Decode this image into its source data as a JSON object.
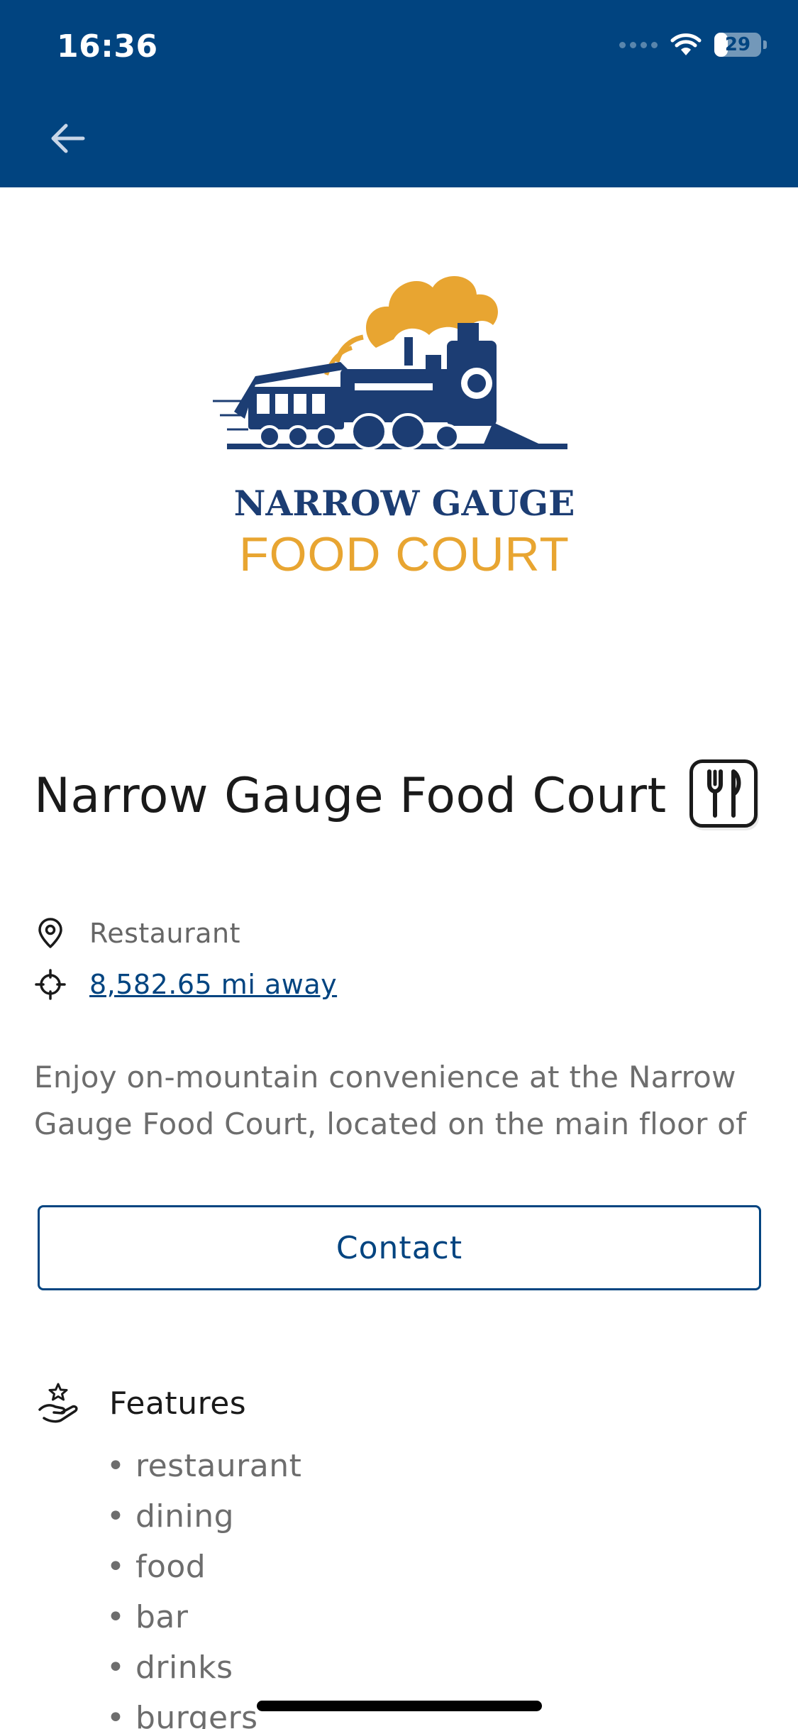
{
  "status_bar": {
    "time": "16:36",
    "battery": "29",
    "battery_level": 0.29
  },
  "header": {
    "back_icon": "arrow-left-icon",
    "color": "#014480"
  },
  "logo": {
    "line1": "NARROW GAUGE",
    "line2": "FOOD COURT",
    "primary_color": "#1c3d73",
    "accent_color": "#e8a531"
  },
  "place": {
    "title": "Narrow Gauge Food Court",
    "category_icon": "fork-knife-icon",
    "category": "Restaurant",
    "distance": "8,582.65 mi away",
    "description": "Enjoy on-mountain convenience at the Narrow Gauge Food Court, located on the main floor of"
  },
  "contact": {
    "label": "Contact"
  },
  "features": {
    "title": "Features",
    "items": [
      "restaurant",
      "dining",
      "food",
      "bar",
      "drinks",
      "burgers"
    ]
  }
}
